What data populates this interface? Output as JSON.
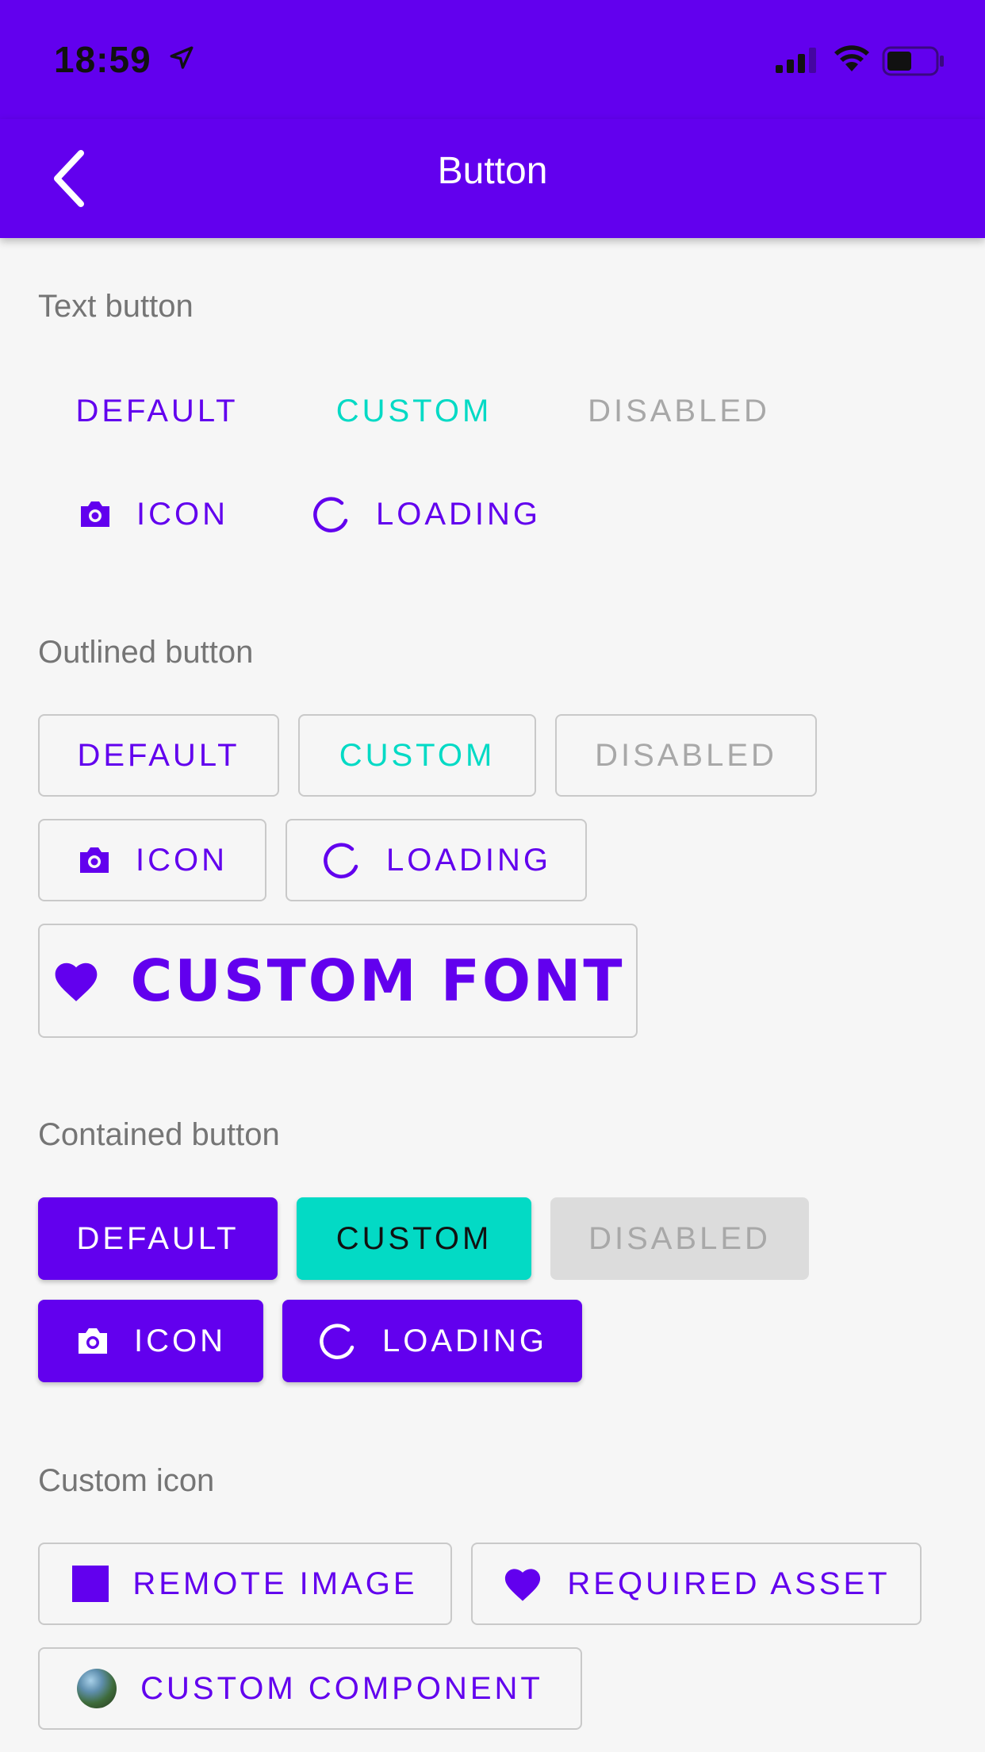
{
  "status_bar": {
    "time": "18:59"
  },
  "app_bar": {
    "title": "Button"
  },
  "sections": {
    "text_button": {
      "label": "Text button",
      "default": "DEFAULT",
      "custom": "CUSTOM",
      "disabled": "DISABLED",
      "icon": "ICON",
      "loading": "LOADING"
    },
    "outlined_button": {
      "label": "Outlined button",
      "default": "DEFAULT",
      "custom": "CUSTOM",
      "disabled": "DISABLED",
      "icon": "ICON",
      "loading": "LOADING",
      "custom_font": "CUSTOM FONT"
    },
    "contained_button": {
      "label": "Contained button",
      "default": "DEFAULT",
      "custom": "CUSTOM",
      "disabled": "DISABLED",
      "icon": "ICON",
      "loading": "LOADING"
    },
    "custom_icon": {
      "label": "Custom icon",
      "remote_image": "REMOTE IMAGE",
      "required_asset": "REQUIRED ASSET",
      "custom_component": "CUSTOM COMPONENT"
    }
  },
  "colors": {
    "primary": "#6200ee",
    "accent": "#03dac5",
    "disabled_text": "#a8a8a8",
    "disabled_bg": "#dcdcdc",
    "background": "#f6f6f6"
  },
  "icons": {
    "back": "chevron-left-icon",
    "camera": "camera-icon",
    "loading": "spinner-icon",
    "heart": "heart-icon",
    "square": "square-icon",
    "avatar": "avatar-image"
  }
}
